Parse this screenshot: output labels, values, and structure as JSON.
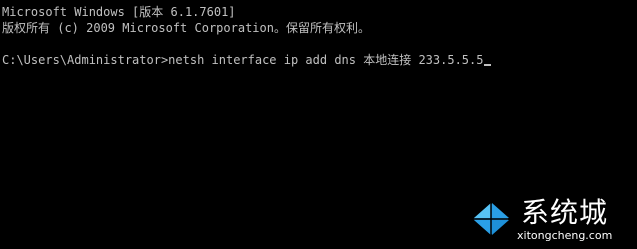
{
  "console": {
    "line1": "Microsoft Windows [版本 6.1.7601]",
    "line2": "版权所有 (c) 2009 Microsoft Corporation。保留所有权利。",
    "prompt_command": "C:\\Users\\Administrator>netsh interface ip add dns 本地连接 233.5.5.5"
  },
  "colors": {
    "background": "#000000",
    "text": "#c0c0c0",
    "logo_blue": "#1e90d8",
    "logo_light": "#57c3f5"
  },
  "watermark": {
    "title": "系统城",
    "url": "xitongcheng.com",
    "icon": "windows-logo-icon"
  }
}
